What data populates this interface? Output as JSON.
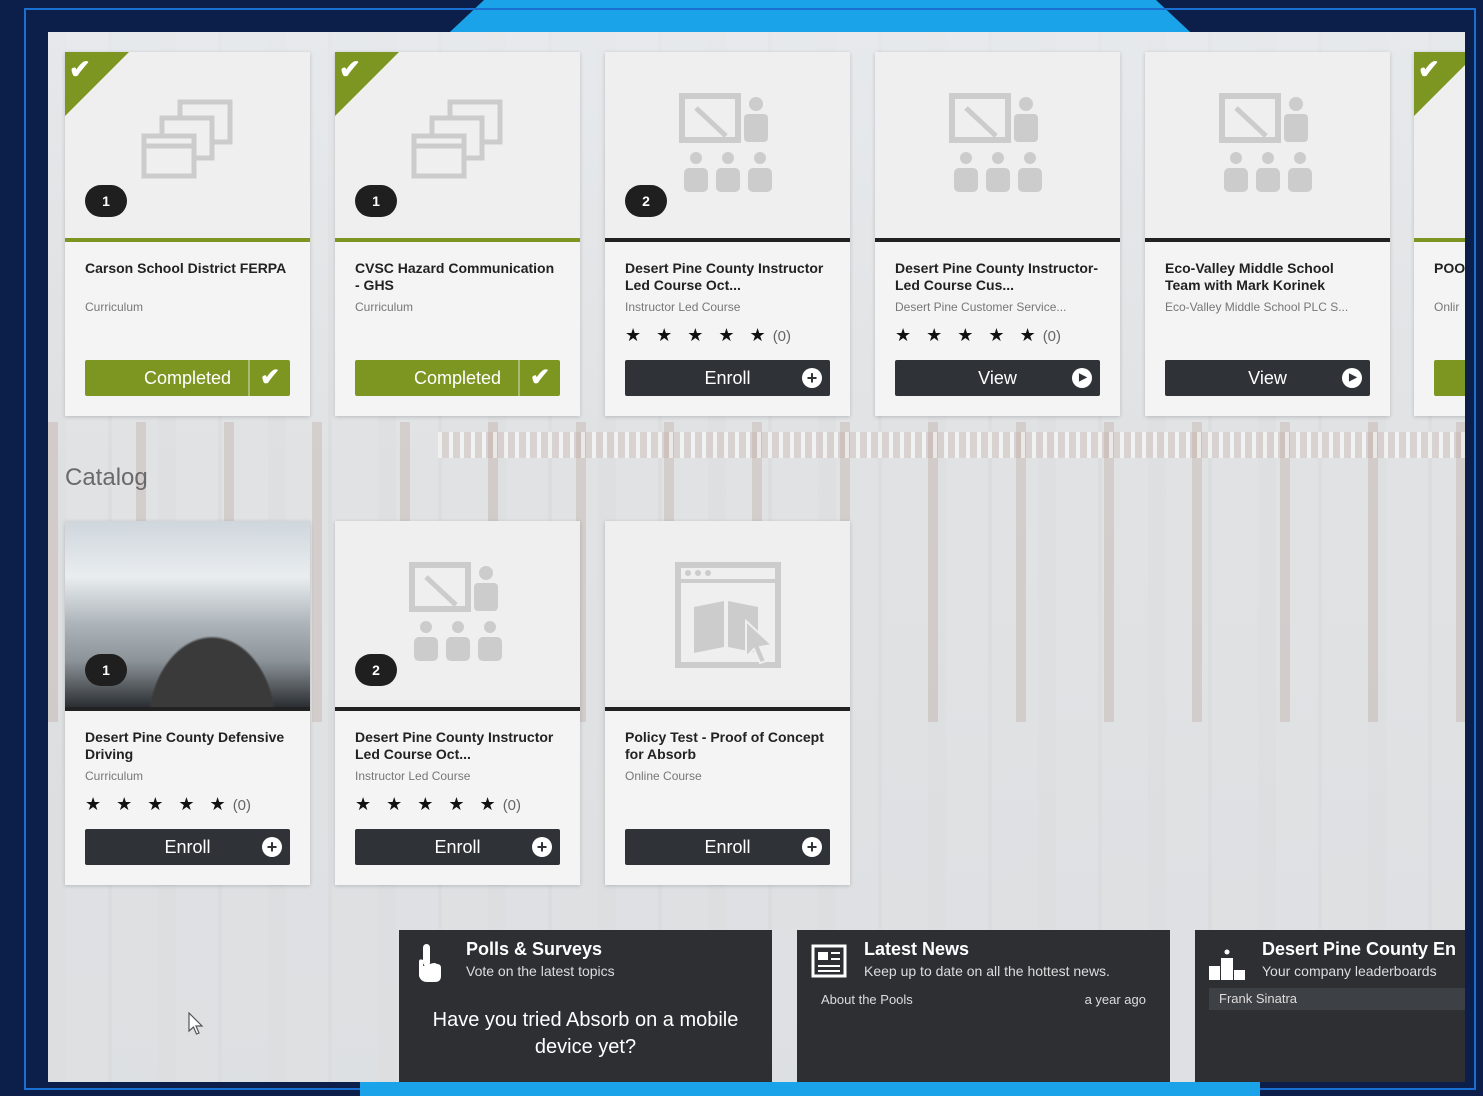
{
  "enrolled_courses": [
    {
      "title": "Carson School District FERPA",
      "type": "Curriculum",
      "badge": "1",
      "status": "completed",
      "button": "Completed",
      "icon": "windows-icon"
    },
    {
      "title": "CVSC Hazard Communication - GHS",
      "type": "Curriculum",
      "badge": "1",
      "status": "completed",
      "button": "Completed",
      "icon": "windows-icon"
    },
    {
      "title": "Desert Pine County Instructor Led Course Oct...",
      "type": "Instructor Led Course",
      "badge": "2",
      "status": "open",
      "stars": "★ ★ ★ ★ ★",
      "rating_count": "(0)",
      "button": "Enroll",
      "icon": "classroom-icon"
    },
    {
      "title": "Desert Pine County Instructor-Led Course Cus...",
      "type": "Desert Pine Customer Service...",
      "status": "open",
      "stars": "★ ★ ★ ★ ★",
      "rating_count": "(0)",
      "button": "View",
      "icon": "classroom-icon"
    },
    {
      "title": "Eco-Valley Middle School Team with Mark Korinek",
      "type": "Eco-Valley Middle School PLC S...",
      "status": "open",
      "button": "View",
      "icon": "classroom-icon"
    },
    {
      "title": "POO Prot",
      "type": "Onlir",
      "status": "completed",
      "button": ""
    }
  ],
  "catalog": {
    "label": "Catalog",
    "courses": [
      {
        "title": "Desert Pine County Defensive Driving",
        "type": "Curriculum",
        "badge": "1",
        "stars": "★ ★ ★ ★ ★",
        "rating_count": "(0)",
        "button": "Enroll",
        "image": "snowy-road-photo"
      },
      {
        "title": "Desert Pine County Instructor Led Course Oct...",
        "type": "Instructor Led Course",
        "badge": "2",
        "stars": "★ ★ ★ ★ ★",
        "rating_count": "(0)",
        "button": "Enroll",
        "icon": "classroom-icon"
      },
      {
        "title": "Policy Test - Proof of Concept for Absorb",
        "type": "Online Course",
        "button": "Enroll",
        "icon": "online-course-icon"
      }
    ]
  },
  "widgets": {
    "polls": {
      "title": "Polls & Surveys",
      "subtitle": "Vote on the latest topics",
      "question": "Have you tried Absorb on a mobile device yet?",
      "icon": "hand-pointer-icon"
    },
    "news": {
      "title": "Latest News",
      "subtitle": "Keep up to date on all the hottest news.",
      "item": "About the Pools",
      "item_time": "a year ago",
      "icon": "newspaper-icon"
    },
    "leaderboard": {
      "title": "Desert Pine County En",
      "subtitle": "Your company leaderboards",
      "top_user": "Frank Sinatra",
      "icon": "podium-icon"
    }
  },
  "colors": {
    "completed_green": "#7d9622",
    "button_dark": "#2f3236",
    "frame_blue": "#1aa3e8",
    "frame_navy": "#0c1e4a"
  }
}
